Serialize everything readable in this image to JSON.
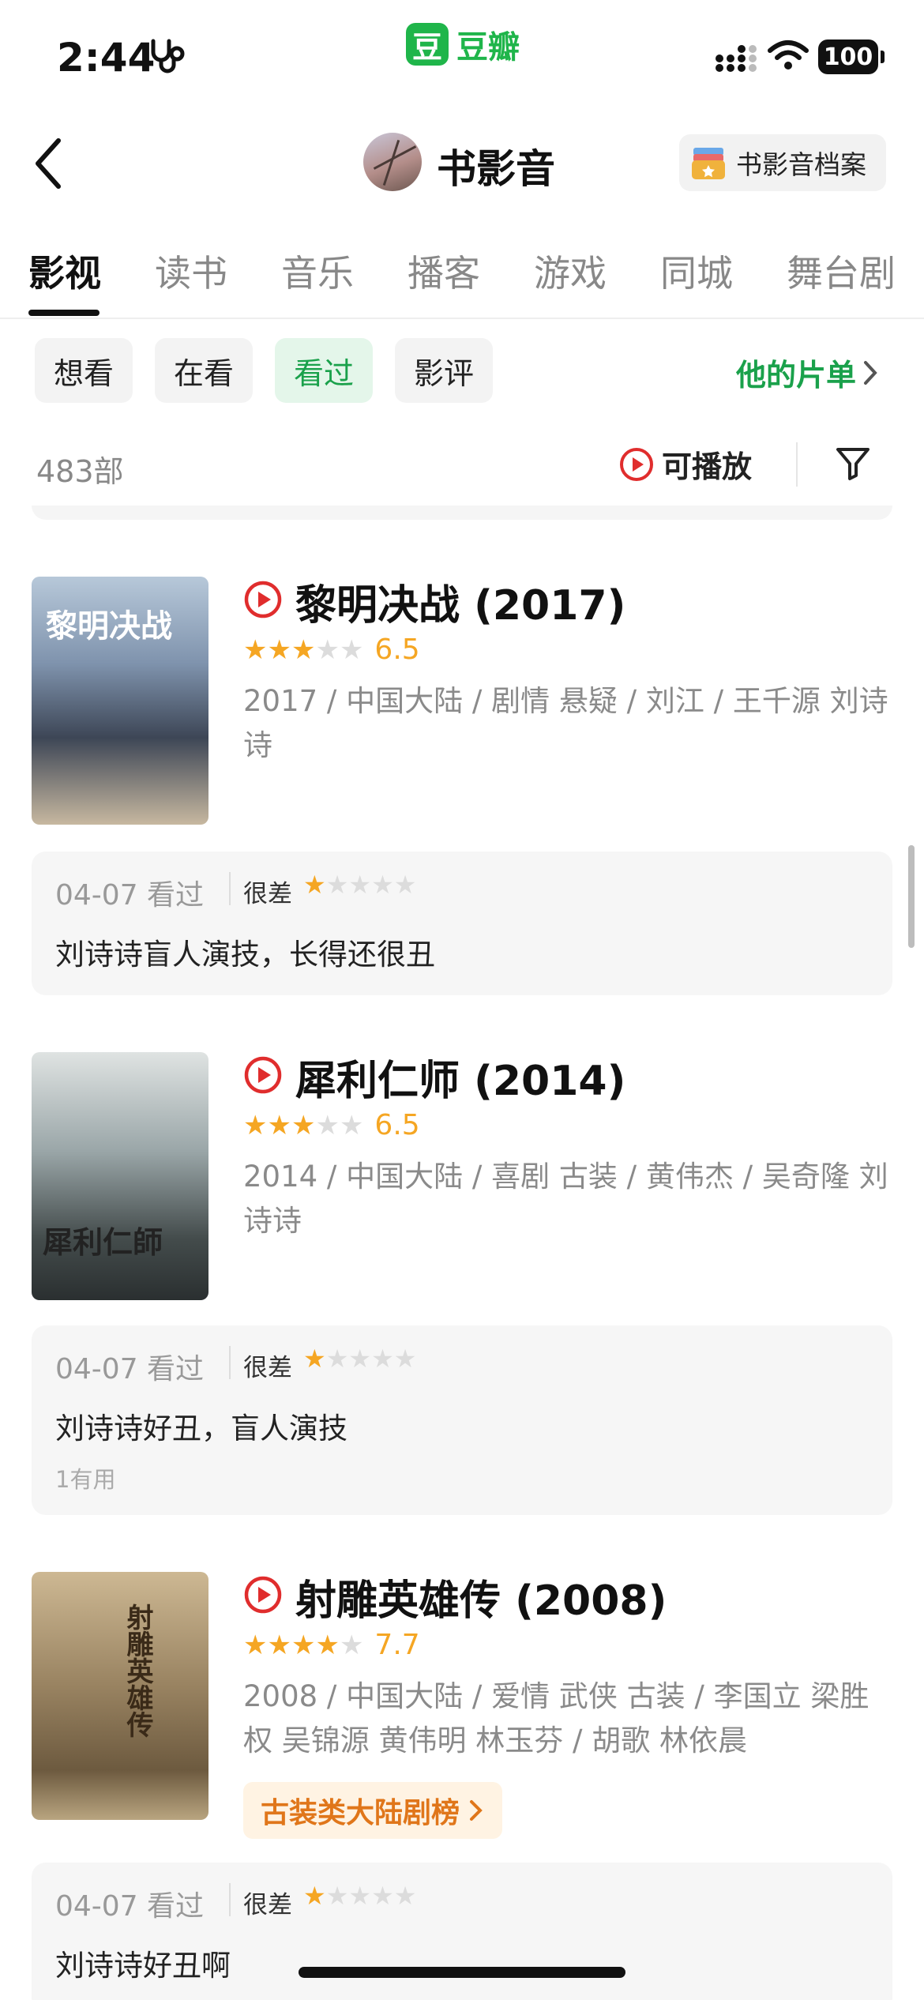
{
  "status_bar": {
    "time": "2:44",
    "app_logo_char": "豆",
    "app_name": "豆瓣",
    "battery": "100"
  },
  "header": {
    "title": "书影音",
    "archive_button": "书影音档案"
  },
  "tabs": [
    "影视",
    "读书",
    "音乐",
    "播客",
    "游戏",
    "同城",
    "舞台剧"
  ],
  "active_tab": 0,
  "filters": {
    "chips": [
      "想看",
      "在看",
      "看过",
      "影评"
    ],
    "active_chip": 2,
    "others_list_link": "他的片单"
  },
  "list_bar": {
    "count": "483部",
    "playable_label": "可播放"
  },
  "movies": [
    {
      "title": "黎明决战 (2017)",
      "stars": 3,
      "score": "6.5",
      "meta": "2017 / 中国大陆 / 剧情 悬疑 / 刘江 / 王千源 刘诗诗",
      "poster_art": "黎明决战",
      "review": {
        "date": "04-07 看过",
        "level": "很差",
        "stars": 1,
        "text": "刘诗诗盲人演技，长得还很丑"
      }
    },
    {
      "title": "犀利仁师 (2014)",
      "stars": 3,
      "score": "6.5",
      "meta": "2014 / 中国大陆 / 喜剧 古装 / 黄伟杰 / 吴奇隆 刘诗诗",
      "poster_art": "犀利仁師",
      "review": {
        "date": "04-07 看过",
        "level": "很差",
        "stars": 1,
        "text": "刘诗诗好丑，盲人演技",
        "useful": "1有用"
      }
    },
    {
      "title": "射雕英雄传 (2008)",
      "stars": 4,
      "score": "7.7",
      "meta": "2008 / 中国大陆 / 爱情 武侠 古装 / 李国立 梁胜权 吴锦源 黄伟明 林玉芬 / 胡歌 林依晨",
      "poster_art": "射雕英雄传",
      "rank_chip": "古装类大陆剧榜",
      "review": {
        "date": "04-07 看过",
        "level": "很差",
        "stars": 1,
        "text": "刘诗诗好丑啊"
      }
    }
  ],
  "colors": {
    "brand_green": "#1fb54a",
    "accent_orange": "#f5a623",
    "play_red": "#e02d2d"
  }
}
